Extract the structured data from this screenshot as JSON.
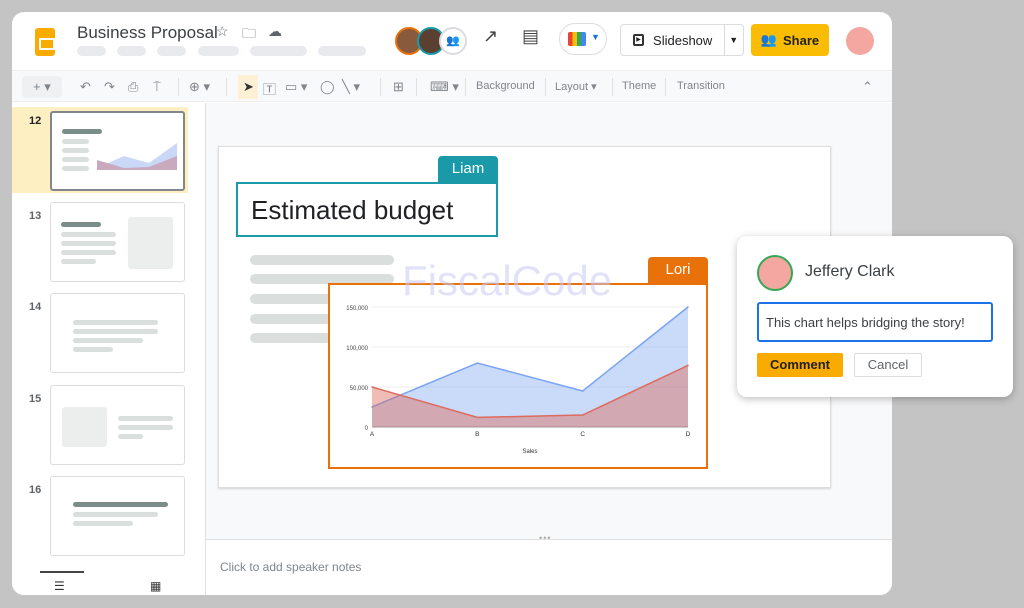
{
  "header": {
    "title": "Business Proposal",
    "menu_count": 6,
    "slideshow_label": "Slideshow",
    "share_label": "Share"
  },
  "toolbar": {
    "background": "Background",
    "layout": "Layout",
    "theme": "Theme",
    "transition": "Transition"
  },
  "filmstrip": {
    "slides": [
      {
        "number": "12",
        "selected": true
      },
      {
        "number": "13"
      },
      {
        "number": "14"
      },
      {
        "number": "15"
      },
      {
        "number": "16"
      }
    ]
  },
  "slide": {
    "title": "Estimated budget",
    "watermark": "FiscalCode",
    "collaborators": [
      {
        "name": "Liam",
        "color": "#1a9aa9"
      },
      {
        "name": "Lori",
        "color": "#e8710a"
      }
    ]
  },
  "chart_data": {
    "type": "area",
    "categories": [
      "A",
      "B",
      "C",
      "D"
    ],
    "xlabel": "Sales",
    "ylabel": "",
    "ylim": [
      0,
      150000
    ],
    "yticks": [
      "0",
      "50,000",
      "100,000",
      "150,000"
    ],
    "grid": true,
    "series": [
      {
        "values": [
          25000,
          80000,
          45000,
          150000
        ],
        "color": "#7ba4f2"
      },
      {
        "values": [
          50000,
          12000,
          15000,
          77000
        ],
        "color": "#dc6b5e"
      }
    ]
  },
  "notes": {
    "placeholder": "Click to add speaker notes"
  },
  "comment": {
    "author": "Jeffery Clark",
    "text": "This chart helps bridging the story!",
    "submit": "Comment",
    "cancel": "Cancel"
  },
  "colors": {
    "accent": "#fbbc04",
    "input_border": "#1a73e8"
  }
}
